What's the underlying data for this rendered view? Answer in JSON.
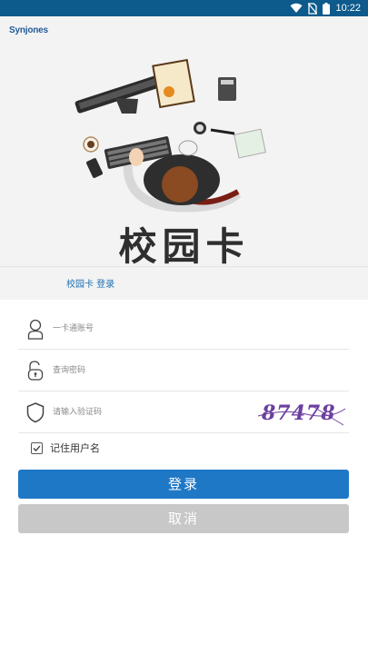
{
  "status_bar": {
    "time": "10:22"
  },
  "hero": {
    "brand": "Synjones",
    "title": "校园卡"
  },
  "tab": {
    "label": "校园卡 登录"
  },
  "form": {
    "account_placeholder": "一卡通账号",
    "password_placeholder": "查询密码",
    "captcha_placeholder": "请输入验证码",
    "captcha_text": "87478",
    "remember_label": "记住用户名"
  },
  "buttons": {
    "login": "登录",
    "cancel": "取消"
  },
  "colors": {
    "status_bar": "#0d5a8c",
    "primary": "#1f78c6",
    "cancel": "#c8c8c8",
    "captcha": "#6b3fa0"
  }
}
